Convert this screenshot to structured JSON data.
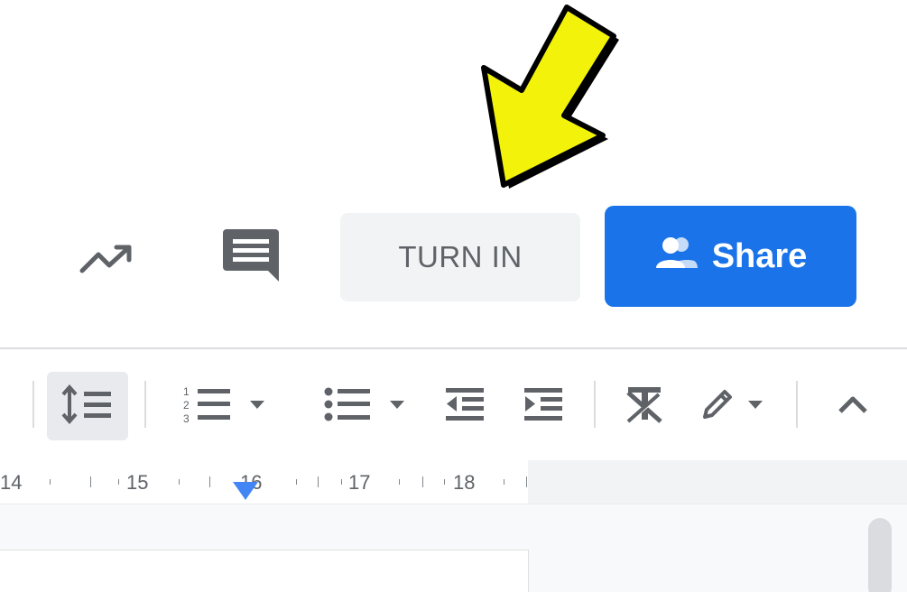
{
  "header": {
    "activity_icon": "activity-dashboard-icon",
    "comment_icon": "comment-icon",
    "turn_in_label": "TURN IN",
    "share_label": "Share",
    "share_icon": "people-icon"
  },
  "annotation": {
    "arrow_icon": "yellow-arrow-icon",
    "arrow_color": "#f2f20a"
  },
  "toolbar": {
    "items": [
      {
        "name": "line-spacing-icon",
        "active": true
      },
      {
        "name": "numbered-list-icon",
        "dropdown": true
      },
      {
        "name": "bulleted-list-icon",
        "dropdown": true
      },
      {
        "name": "decrease-indent-icon"
      },
      {
        "name": "increase-indent-icon"
      },
      {
        "name": "clear-formatting-icon"
      },
      {
        "name": "editing-mode-pencil-icon",
        "dropdown": true
      },
      {
        "name": "collapse-toolbar-icon"
      }
    ]
  },
  "ruler": {
    "labels": [
      "14",
      "15",
      "16",
      "17",
      "18"
    ]
  },
  "colors": {
    "share_blue": "#1a73e8",
    "turn_in_bg": "#f1f3f4",
    "icon_grey": "#5f6368",
    "ruler_marker": "#4285f4"
  }
}
